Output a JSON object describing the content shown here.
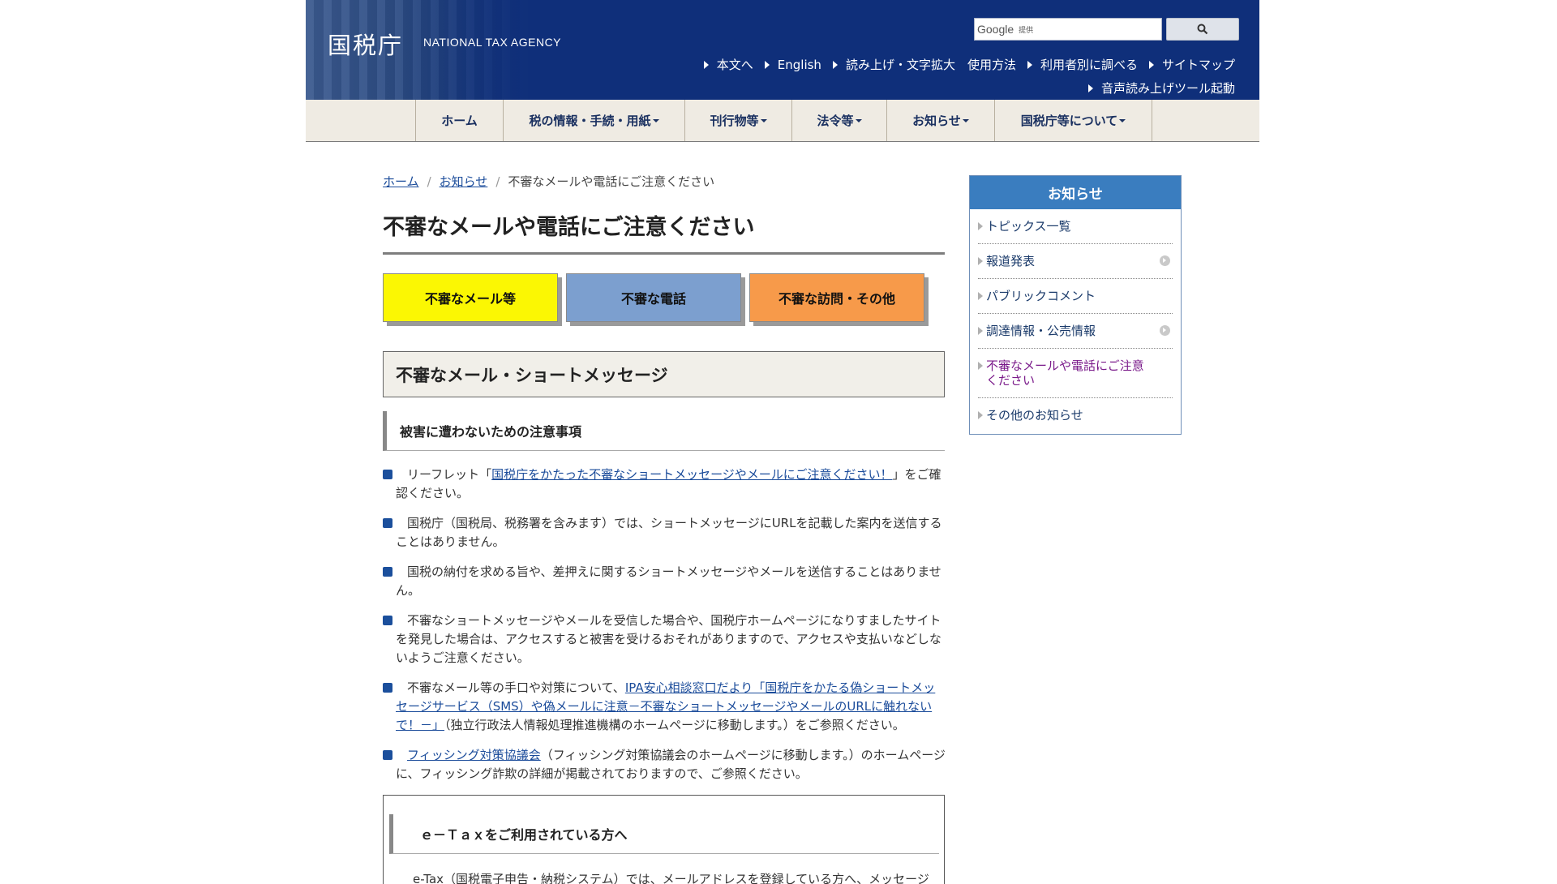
{
  "header": {
    "logo_jp": "国税庁",
    "logo_en": "NATIONAL TAX AGENCY",
    "search": {
      "brand": "Google",
      "provided": "提供",
      "button_icon": "search-icon"
    },
    "links": [
      "本文へ",
      "English",
      "読み上げ・文字拡大　使用方法",
      "利用者別に調べる",
      "サイトマップ"
    ],
    "links2": "音声読み上げツール起動",
    "background_color": "#0f2f7a"
  },
  "gnav": {
    "items": [
      "ホーム",
      "税の情報・手続・用紙",
      "刊行物等",
      "法令等",
      "お知らせ",
      "国税庁等について"
    ]
  },
  "breadcrumb": {
    "home": "ホーム",
    "notices": "お知らせ",
    "current": "不審なメールや電話にご注意ください"
  },
  "page_title": "不審なメールや電話にご注意ください",
  "category_buttons": [
    {
      "label": "不審なメール等",
      "color": "#fbf703"
    },
    {
      "label": "不審な電話",
      "color": "#7c9fcf"
    },
    {
      "label": "不審な訪問・その他",
      "color": "#f79a4a"
    }
  ],
  "section": {
    "heading": "不審なメール・ショートメッセージ",
    "subheading": "被害に遭わないための注意事項"
  },
  "notices": {
    "item1": {
      "before": "リーフレット「",
      "link": "国税庁をかたった不審なショートメッセージやメールにご注意ください！",
      "after": "」をご確認ください。"
    },
    "item2": "国税庁（国税局、税務署を含みます）では、ショートメッセージにURLを記載した案内を送信することはありません。",
    "item3": "国税の納付を求める旨や、差押えに関するショートメッセージやメールを送信することはありません。",
    "item4": "不審なショートメッセージやメールを受信した場合や、国税庁ホームページになりすましたサイトを発見した場合は、アクセスすると被害を受けるおそれがありますので、アクセスや支払いなどしないようご注意ください。",
    "item5": {
      "before": "不審なメール等の手口や対策について、",
      "link": "IPA安心相談窓口だより「国税庁をかたる偽ショートメッセージサービス（SMS）や偽メールに注意－不審なショートメッセージやメールのURLに触れないで！－」",
      "after": "（独立行政法人情報処理推進機構のホームページに移動します。）をご参照ください。"
    },
    "item6": {
      "link": "フィッシング対策協議会",
      "after": "（フィッシング対策協議会のホームページに移動します。）のホームページに、フィッシング詐欺の詳細が掲載されておりますので、ご参照ください。"
    }
  },
  "etax": {
    "heading": "ｅ－Ｔａｘをご利用されている方へ",
    "text": "e-Tax（国税電子申告・納税システム）では、メールアドレスを登録している方へ、メッセージ"
  },
  "sidebar": {
    "title": "お知らせ",
    "items": [
      {
        "label": "トピックス一覧"
      },
      {
        "label": "報道発表"
      },
      {
        "label": "パブリックコメント"
      },
      {
        "label": "調達情報・公売情報"
      },
      {
        "label": "不審なメールや電話にご注意ください"
      },
      {
        "label": "その他のお知らせ"
      }
    ]
  }
}
